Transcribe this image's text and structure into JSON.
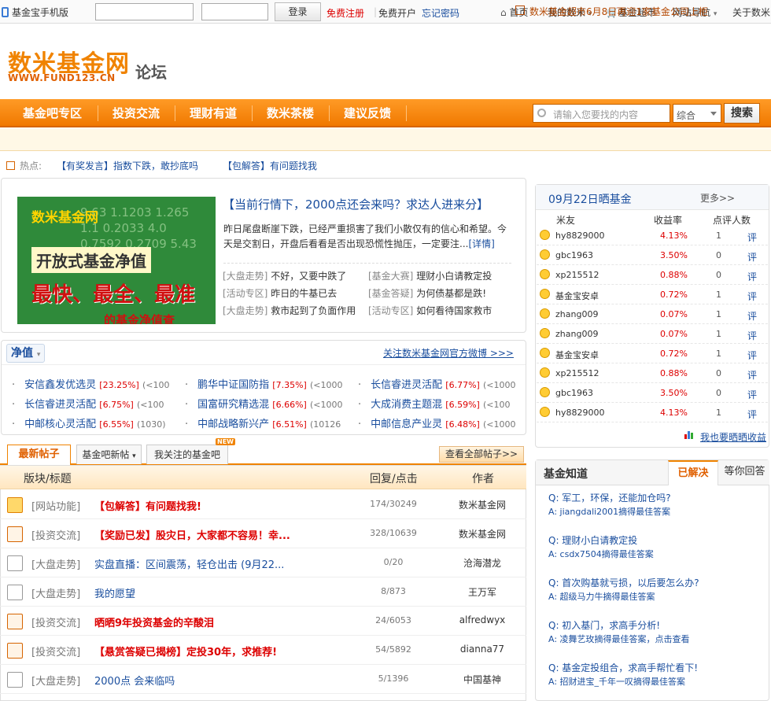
{
  "topbar": {
    "phone": "基金宝手机版",
    "login": "登录",
    "register": "免费注册",
    "open": "免费开户",
    "forgot": "忘记密码",
    "home": "首页",
    "my": "我的数米",
    "shop": "基金超市",
    "sitenav": "网站导航",
    "about": "关于数米"
  },
  "header": {
    "logo": "数米基金网",
    "url": "WWW.FUND123.CN",
    "forum": "论坛"
  },
  "nav": [
    "基金吧专区",
    "投资交流",
    "理财有道",
    "数米茶楼",
    "建议反馈"
  ],
  "search": {
    "placeholder": "请输入您要找的内容",
    "select": "综合",
    "button": "搜索"
  },
  "notice": "数米基金超市6月8日再迎1家基金公司上柜",
  "hot": {
    "label": "热点:",
    "items": [
      "【有奖发言】指数下跌，敢抄底吗",
      "【包解答】有问题找我"
    ]
  },
  "featured": {
    "banner": {
      "logo": "数米基金网",
      "title": "开放式基金净值",
      "slogan": "最快、最全、最准",
      "sub": "的基金净值查"
    },
    "title": "【当前行情下，2000点还会来吗？求达人进来分】",
    "desc": "昨日尾盘断崖下跌，已经严重损害了我们小散仅有的信心和希望。今天是交割日，开盘后看看是否出现恐慌性抛压，一定要注...",
    "detail": "[详情]",
    "links": [
      {
        "tag": "[大盘走势]",
        "text": "不好，又要中跌了"
      },
      {
        "tag": "[基金大赛]",
        "text": "理财小白请教定投"
      },
      {
        "tag": "[活动专区]",
        "text": "昨日的牛基已去"
      },
      {
        "tag": "[基金答疑]",
        "text": "为何债基都是跌!"
      },
      {
        "tag": "[大盘走势]",
        "text": "救市起到了负面作用"
      },
      {
        "tag": "[活动专区]",
        "text": "如何看待国家救市"
      }
    ]
  },
  "netvalue": {
    "tag": "净值",
    "follow": "关注数米基金网官方微博 >>>",
    "items": [
      {
        "name": "安信鑫发优选灵",
        "pct": "23.25%",
        "n": "(<100"
      },
      {
        "name": "鹏华中证国防指",
        "pct": "7.35%",
        "n": "(<1000"
      },
      {
        "name": "长信睿进灵活配",
        "pct": "6.77%",
        "n": "(<1000"
      },
      {
        "name": "长信睿进灵活配",
        "pct": "6.75%",
        "n": "(<100"
      },
      {
        "name": "国富研究精选混",
        "pct": "6.66%",
        "n": "(<1000"
      },
      {
        "name": "大成消费主题混",
        "pct": "6.59%",
        "n": "(<100"
      },
      {
        "name": "中邮核心灵活配",
        "pct": "6.55%",
        "n": "(1030)"
      },
      {
        "name": "中邮战略新兴产",
        "pct": "6.51%",
        "n": "(10126"
      },
      {
        "name": "中邮信息产业灵",
        "pct": "6.48%",
        "n": "(<1000"
      }
    ]
  },
  "posts": {
    "tabs": [
      "最新帖子",
      "基金吧新帖",
      "我关注的基金吧"
    ],
    "new_badge": "NEW",
    "all": "查看全部帖子>>",
    "head": {
      "title": "版块/标题",
      "count": "回复/点击",
      "author": "作者"
    },
    "rows": [
      {
        "sec": "[网站功能]",
        "title": "【包解答】有问题找我!",
        "cnt": "174/30249",
        "author": "数米基金网",
        "red": true,
        "bold": true
      },
      {
        "sec": "[投资交流]",
        "title": "【奖励已发】股灾日，大家都不容易！幸...",
        "cnt": "328/10639",
        "author": "数米基金网",
        "red": true,
        "bold": true
      },
      {
        "sec": "[大盘走势]",
        "title": "实盘直播：区间震荡，轻仓出击 (9月22...",
        "cnt": "0/20",
        "author": "沧海潜龙",
        "red": false,
        "bold": false
      },
      {
        "sec": "[大盘走势]",
        "title": "我的愿望",
        "cnt": "8/873",
        "author": "王万军",
        "red": false,
        "bold": false
      },
      {
        "sec": "[投资交流]",
        "title": "晒晒9年投资基金的辛酸泪",
        "cnt": "24/6053",
        "author": "alfredwyx",
        "red": true,
        "bold": true
      },
      {
        "sec": "[投资交流]",
        "title": "【悬赏答疑已揭榜】定投30年，求推荐!",
        "cnt": "54/5892",
        "author": "dianna77",
        "red": true,
        "bold": true
      },
      {
        "sec": "[大盘走势]",
        "title": "2000点 会来临吗",
        "cnt": "5/1396",
        "author": "中国基神",
        "red": false,
        "bold": false
      }
    ]
  },
  "shaijijin": {
    "title": "09月22日晒基金",
    "more": "更多>>",
    "head": {
      "user": "米友",
      "rate": "收益率",
      "num": "点评人数"
    },
    "rows": [
      {
        "name": "hy8829000",
        "rate": "4.13%",
        "num": "1",
        "act": "评"
      },
      {
        "name": "gbc1963",
        "rate": "3.50%",
        "num": "0",
        "act": "评"
      },
      {
        "name": "xp215512",
        "rate": "0.88%",
        "num": "0",
        "act": "评"
      },
      {
        "name": "基金宝安卓",
        "rate": "0.72%",
        "num": "1",
        "act": "评"
      },
      {
        "name": "zhang009",
        "rate": "0.07%",
        "num": "1",
        "act": "评"
      },
      {
        "name": "zhang009",
        "rate": "0.07%",
        "num": "1",
        "act": "评"
      },
      {
        "name": "基金宝安卓",
        "rate": "0.72%",
        "num": "1",
        "act": "评"
      },
      {
        "name": "xp215512",
        "rate": "0.88%",
        "num": "0",
        "act": "评"
      },
      {
        "name": "gbc1963",
        "rate": "3.50%",
        "num": "0",
        "act": "评"
      },
      {
        "name": "hy8829000",
        "rate": "4.13%",
        "num": "1",
        "act": "评"
      }
    ],
    "foot": "我也要晒晒收益"
  },
  "zhidao": {
    "title": "基金知道",
    "tabs": [
      "已解决",
      "等你回答"
    ],
    "items": [
      {
        "q": "Q: 军工，环保，还能加仓吗?",
        "a": "A: jiangdali2001摘得最佳答案"
      },
      {
        "q": "Q: 理财小白请教定投",
        "a": "A: csdx7504摘得最佳答案"
      },
      {
        "q": "Q: 首次购基就亏损，以后要怎么办?",
        "a": "A: 超级马力牛摘得最佳答案"
      },
      {
        "q": "Q: 初入基门，求高手分析!",
        "a": "A: 凌舞艺玫摘得最佳答案，点击查看"
      },
      {
        "q": "Q: 基金定投组合，求高手帮忙看下!",
        "a": "A: 招财进宝_千年一叹摘得最佳答案"
      }
    ]
  },
  "colors": {
    "accent": "#f08300",
    "link": "#1a4e9e",
    "red": "#dd0000"
  }
}
